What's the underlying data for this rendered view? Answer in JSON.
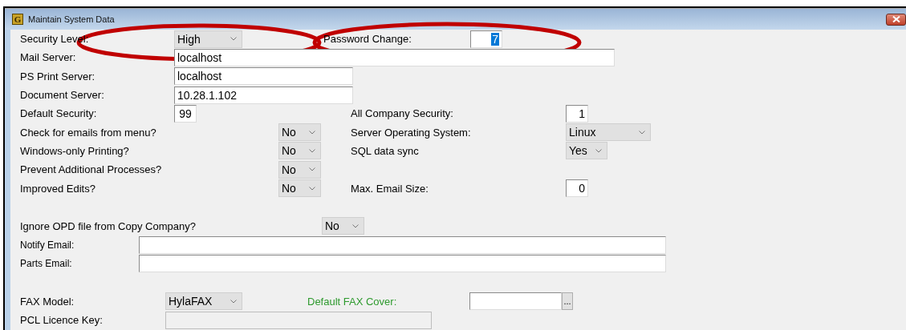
{
  "window": {
    "title": "Maintain System Data",
    "icon_letter": "G"
  },
  "security_level": {
    "label": "Security Level:",
    "value": "High"
  },
  "password_change": {
    "label": "Password Change:",
    "value": "7",
    "text_selected": true
  },
  "mail_server": {
    "label": "Mail Server:",
    "value": "localhost"
  },
  "ps_print_server": {
    "label": "PS Print Server:",
    "value": "localhost"
  },
  "document_server": {
    "label": "Document Server:",
    "value": "10.28.1.102"
  },
  "default_security": {
    "label": "Default Security:",
    "value": "99"
  },
  "all_company_security": {
    "label": "All Company Security:",
    "value": "1"
  },
  "check_emails": {
    "label": "Check for emails from menu?",
    "value": "No"
  },
  "server_os": {
    "label": "Server Operating System:",
    "value": "Linux"
  },
  "windows_printing": {
    "label": "Windows-only Printing?",
    "value": "No"
  },
  "sql_sync": {
    "label": "SQL data sync",
    "value": "Yes"
  },
  "prevent_processes": {
    "label": "Prevent Additional Processes?",
    "value": "No"
  },
  "improved_edits": {
    "label": "Improved Edits?",
    "value": "No"
  },
  "max_email_size": {
    "label": "Max. Email Size:",
    "value": "0"
  },
  "ignore_opd": {
    "label": "Ignore OPD file from Copy Company?",
    "value": "No"
  },
  "notify_email": {
    "label": "Notify Email:"
  },
  "parts_email": {
    "label": "Parts Email:"
  },
  "fax_model": {
    "label": "FAX Model:",
    "value": "HylaFAX"
  },
  "default_fax_cover": {
    "label": "Default FAX Cover:",
    "browse": "..."
  },
  "pcl_licence_key": {
    "label": "PCL Licence Key:",
    "disabled": true
  },
  "annotations": [
    {
      "kind": "ellipse"
    },
    {
      "kind": "ellipse"
    }
  ]
}
